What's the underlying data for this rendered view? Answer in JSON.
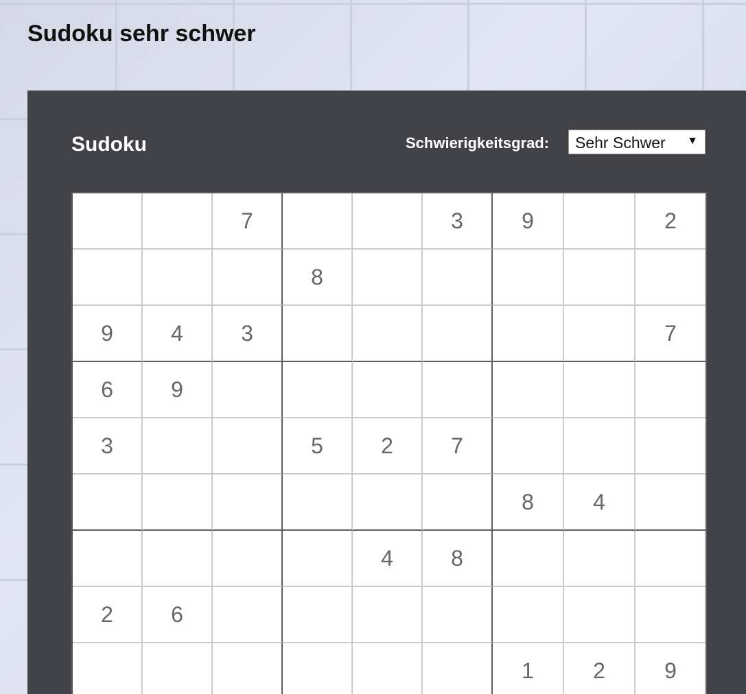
{
  "page": {
    "title": "Sudoku sehr schwer"
  },
  "panel": {
    "title": "Sudoku",
    "difficulty_label": "Schwierigkeitsgrad:",
    "difficulty_value": "Sehr Schwer",
    "difficulty_arrow": "▼"
  },
  "grid": {
    "rows": [
      [
        "",
        "",
        "7",
        "",
        "",
        "3",
        "9",
        "",
        "2"
      ],
      [
        "",
        "",
        "",
        "8",
        "",
        "",
        "",
        "",
        ""
      ],
      [
        "9",
        "4",
        "3",
        "",
        "",
        "",
        "",
        "",
        "7"
      ],
      [
        "6",
        "9",
        "",
        "",
        "",
        "",
        "",
        "",
        ""
      ],
      [
        "3",
        "",
        "",
        "5",
        "2",
        "7",
        "",
        "",
        ""
      ],
      [
        "",
        "",
        "",
        "",
        "",
        "",
        "8",
        "4",
        ""
      ],
      [
        "",
        "",
        "",
        "",
        "4",
        "8",
        "",
        "",
        ""
      ],
      [
        "2",
        "6",
        "",
        "",
        "",
        "",
        "",
        "",
        ""
      ],
      [
        "",
        "",
        "",
        "",
        "",
        "",
        "1",
        "2",
        "9"
      ]
    ]
  },
  "colors": {
    "panel_bg": "#404247",
    "grid_bg": "#ffffff",
    "thin_line": "#cccccc",
    "box_line": "#5b5d62",
    "digit": "#666666"
  }
}
